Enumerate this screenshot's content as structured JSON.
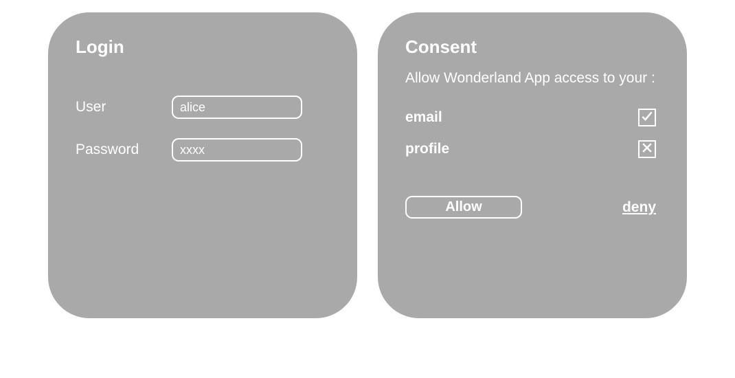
{
  "login": {
    "title": "Login",
    "user_label": "User",
    "user_value": "alice",
    "password_label": "Password",
    "password_value": "xxxx"
  },
  "consent": {
    "title": "Consent",
    "prompt": "Allow Wonderland App access to your :",
    "scopes": [
      {
        "label": "email",
        "checked": true
      },
      {
        "label": "profile",
        "checked": false
      }
    ],
    "allow_label": "Allow",
    "deny_label": "deny"
  }
}
